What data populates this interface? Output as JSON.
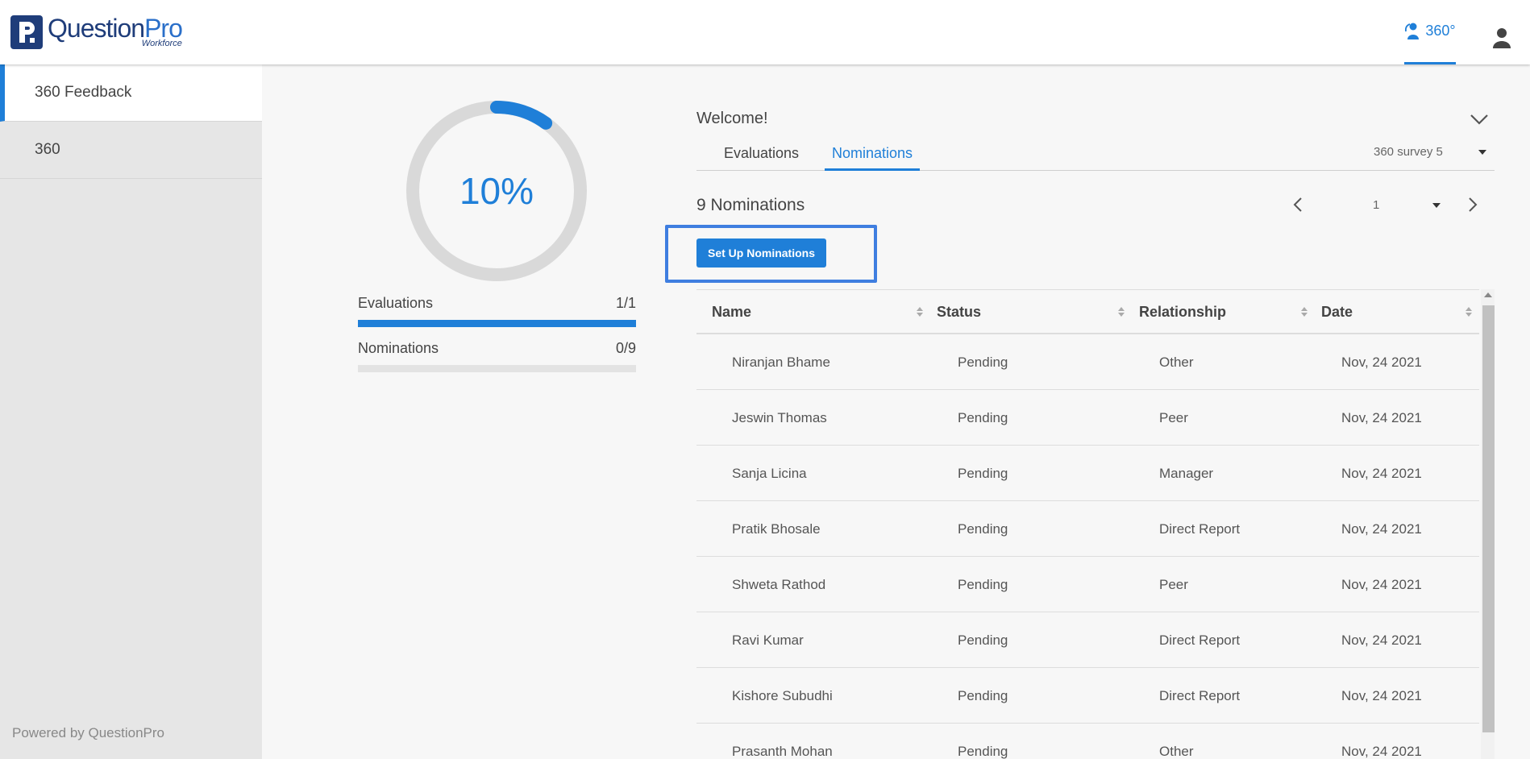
{
  "header": {
    "logo_main": "Question",
    "logo_accent": "Pro",
    "logo_sub": "Workforce",
    "nav_label": "360°"
  },
  "sidebar": {
    "items": [
      {
        "label": "360 Feedback",
        "active": true
      },
      {
        "label": "360",
        "active": false
      }
    ],
    "powered_by": "Powered by QuestionPro"
  },
  "progress": {
    "percent_label": "10%",
    "percent": 10,
    "evaluations": {
      "label": "Evaluations",
      "value": "1/1",
      "fraction": 1.0
    },
    "nominations": {
      "label": "Nominations",
      "value": "0/9",
      "fraction": 0.0
    }
  },
  "main": {
    "welcome": "Welcome!",
    "tabs": [
      {
        "label": "Evaluations",
        "active": false
      },
      {
        "label": "Nominations",
        "active": true
      }
    ],
    "survey_select": "360 survey 5",
    "count_title": "9 Nominations",
    "page_number": "1",
    "setup_button": "Set Up Nominations",
    "columns": [
      "Name",
      "Status",
      "Relationship",
      "Date"
    ],
    "rows": [
      {
        "name": "Niranjan Bhame",
        "status": "Pending",
        "relationship": "Other",
        "date": "Nov, 24 2021"
      },
      {
        "name": "Jeswin Thomas",
        "status": "Pending",
        "relationship": "Peer",
        "date": "Nov, 24 2021"
      },
      {
        "name": "Sanja Licina",
        "status": "Pending",
        "relationship": "Manager",
        "date": "Nov, 24 2021"
      },
      {
        "name": "Pratik Bhosale",
        "status": "Pending",
        "relationship": "Direct Report",
        "date": "Nov, 24 2021"
      },
      {
        "name": "Shweta Rathod",
        "status": "Pending",
        "relationship": "Peer",
        "date": "Nov, 24 2021"
      },
      {
        "name": "Ravi Kumar",
        "status": "Pending",
        "relationship": "Direct Report",
        "date": "Nov, 24 2021"
      },
      {
        "name": "Kishore Subudhi",
        "status": "Pending",
        "relationship": "Direct Report",
        "date": "Nov, 24 2021"
      },
      {
        "name": "Prasanth Mohan",
        "status": "Pending",
        "relationship": "Other",
        "date": "Nov, 24 2021"
      }
    ]
  },
  "colors": {
    "accent": "#1f7fd8",
    "brand": "#1f3d7a",
    "focus_outline": "#3f7ee0"
  }
}
